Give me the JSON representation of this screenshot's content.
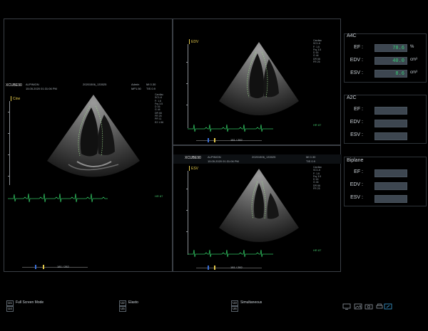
{
  "views": {
    "main": {
      "title": "XCUBE90",
      "patient": "ALPINION",
      "datetime": "15.05.2020 01:31:06 PM",
      "study": "20201506_133025",
      "user": "Admin",
      "mi": "MI 0.30",
      "tis": "TIS 0.9",
      "mp": "MP1.50",
      "mode_label": "Cine",
      "params": [
        "Cardiac",
        "SC1-6",
        "F: 1.6",
        "Frq 3.5",
        "D 16",
        "G 44",
        "DR 66",
        "FR 25",
        "PR 11",
        "E2 1.56"
      ],
      "hr": "HR 87",
      "frame": "181 / 282"
    },
    "edv": {
      "title": "XCUBE90",
      "patient": "ALPINION",
      "datetime": "15.05.2020 01:31:06 PM",
      "study": "20201506_133025",
      "mi": "MI 0.30",
      "tis": "TIS 0.9",
      "mode_label": "EDV",
      "params": [
        "Cardiac",
        "SC1-6",
        "F: 1.6",
        "Frq 3.5",
        "D 16",
        "G 44",
        "DR 66",
        "FR 25"
      ],
      "hr": "HR 87",
      "frame": "181 / 282"
    },
    "esv": {
      "title": "XCUBE90",
      "patient": "ALPINION",
      "datetime": "15.05.2020 01:31:06 PM",
      "study": "20201506_133025",
      "mi": "MI 0.30",
      "tis": "TIS 0.9",
      "mode_label": "ESV",
      "params": [
        "Cardiac",
        "SC1-6",
        "F: 1.6",
        "Frq 3.5",
        "D 16",
        "G 44",
        "DR 66",
        "FR 25"
      ],
      "hr": "HR 87",
      "frame": "181 / 282"
    }
  },
  "results": {
    "a4c": {
      "title": "A4C",
      "ef_label": "EF :",
      "ef_value": "78.6",
      "ef_unit": "%",
      "edv_label": "EDV :",
      "edv_value": "40.0",
      "edv_unit": "cm³",
      "esv_label": "ESV :",
      "esv_value": "8.6",
      "esv_unit": "cm³"
    },
    "a2c": {
      "title": "A2C",
      "ef_label": "EF :",
      "edv_label": "EDV :",
      "esv_label": "ESV :"
    },
    "biplane": {
      "title": "Biplane",
      "ef_label": "EF :",
      "edv_label": "EDV :",
      "esv_label": "ESV :"
    }
  },
  "softkeys": {
    "u1": "U1",
    "u1_label": "Full Screen Mode",
    "u4": "U4",
    "u2": "U2",
    "u2_label": "Elasto",
    "u5": "U5",
    "u3": "U3",
    "u3_label": "Simultaneous",
    "u6": "U6"
  },
  "tray_icons": [
    "monitor-icon",
    "image-icon",
    "camera-icon",
    "print-icon",
    "export-icon"
  ],
  "colors": {
    "accent_value": "#39d07a",
    "ecg": "#2fbf5f",
    "cine": "#e3c84a",
    "box_bg": "#3d4650"
  }
}
